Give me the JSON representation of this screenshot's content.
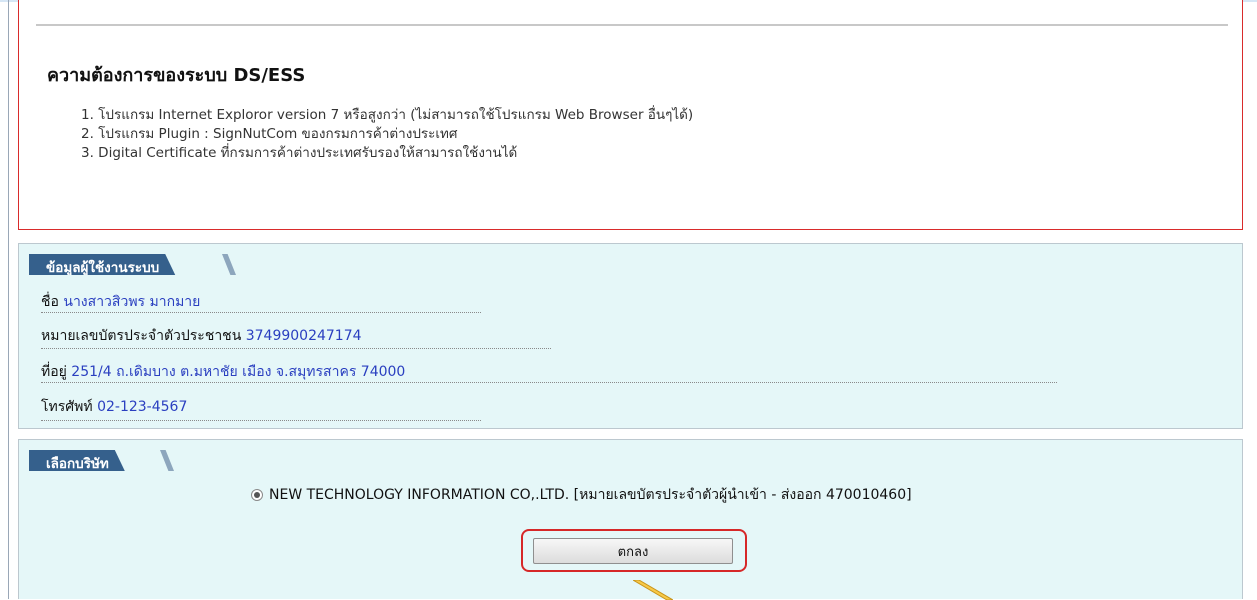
{
  "requirements": {
    "title": "ความต้องการของระบบ DS/ESS",
    "items": [
      "1. โปรแกรม Internet Exploror version 7 หรือสูงกว่า (ไม่สามารถใช้โปรแกรม Web Browser อื่นๆได้)",
      "2. โปรแกรม Plugin : SignNutCom ของกรมการค้าต่างประเทศ",
      "3. Digital Certificate ที่กรมการค้าต่างประเทศรับรองให้สามารถใช้งานได้"
    ]
  },
  "user_info": {
    "tab_label": "ข้อมูลผู้ใช้งานระบบ",
    "name_label": "ชื่อ",
    "name_value": "นางสาวสิวพร มากมาย",
    "id_label": "หมายเลขบัตรประจำตัวประชาชน",
    "id_value": "3749900247174",
    "address_label": "ที่อยู่",
    "address_value": "251/4 ถ.เดิมบาง ต.มหาชัย เมือง จ.สมุทรสาคร 74000",
    "phone_label": "โทรศัพท์",
    "phone_value": "02-123-4567"
  },
  "company": {
    "tab_label": "เลือกบริษัท",
    "option_label": "NEW TECHNOLOGY INFORMATION CO,.LTD. [หมายเลขบัตรประจำตัวผู้นำเข้า - ส่งออก 470010460]",
    "ok_button_label": "ตกลง"
  },
  "colors": {
    "panel_bg": "#e5f7f8",
    "tab_bg": "#35608c",
    "highlight": "#d62828",
    "value_text": "#2a3fc0"
  }
}
